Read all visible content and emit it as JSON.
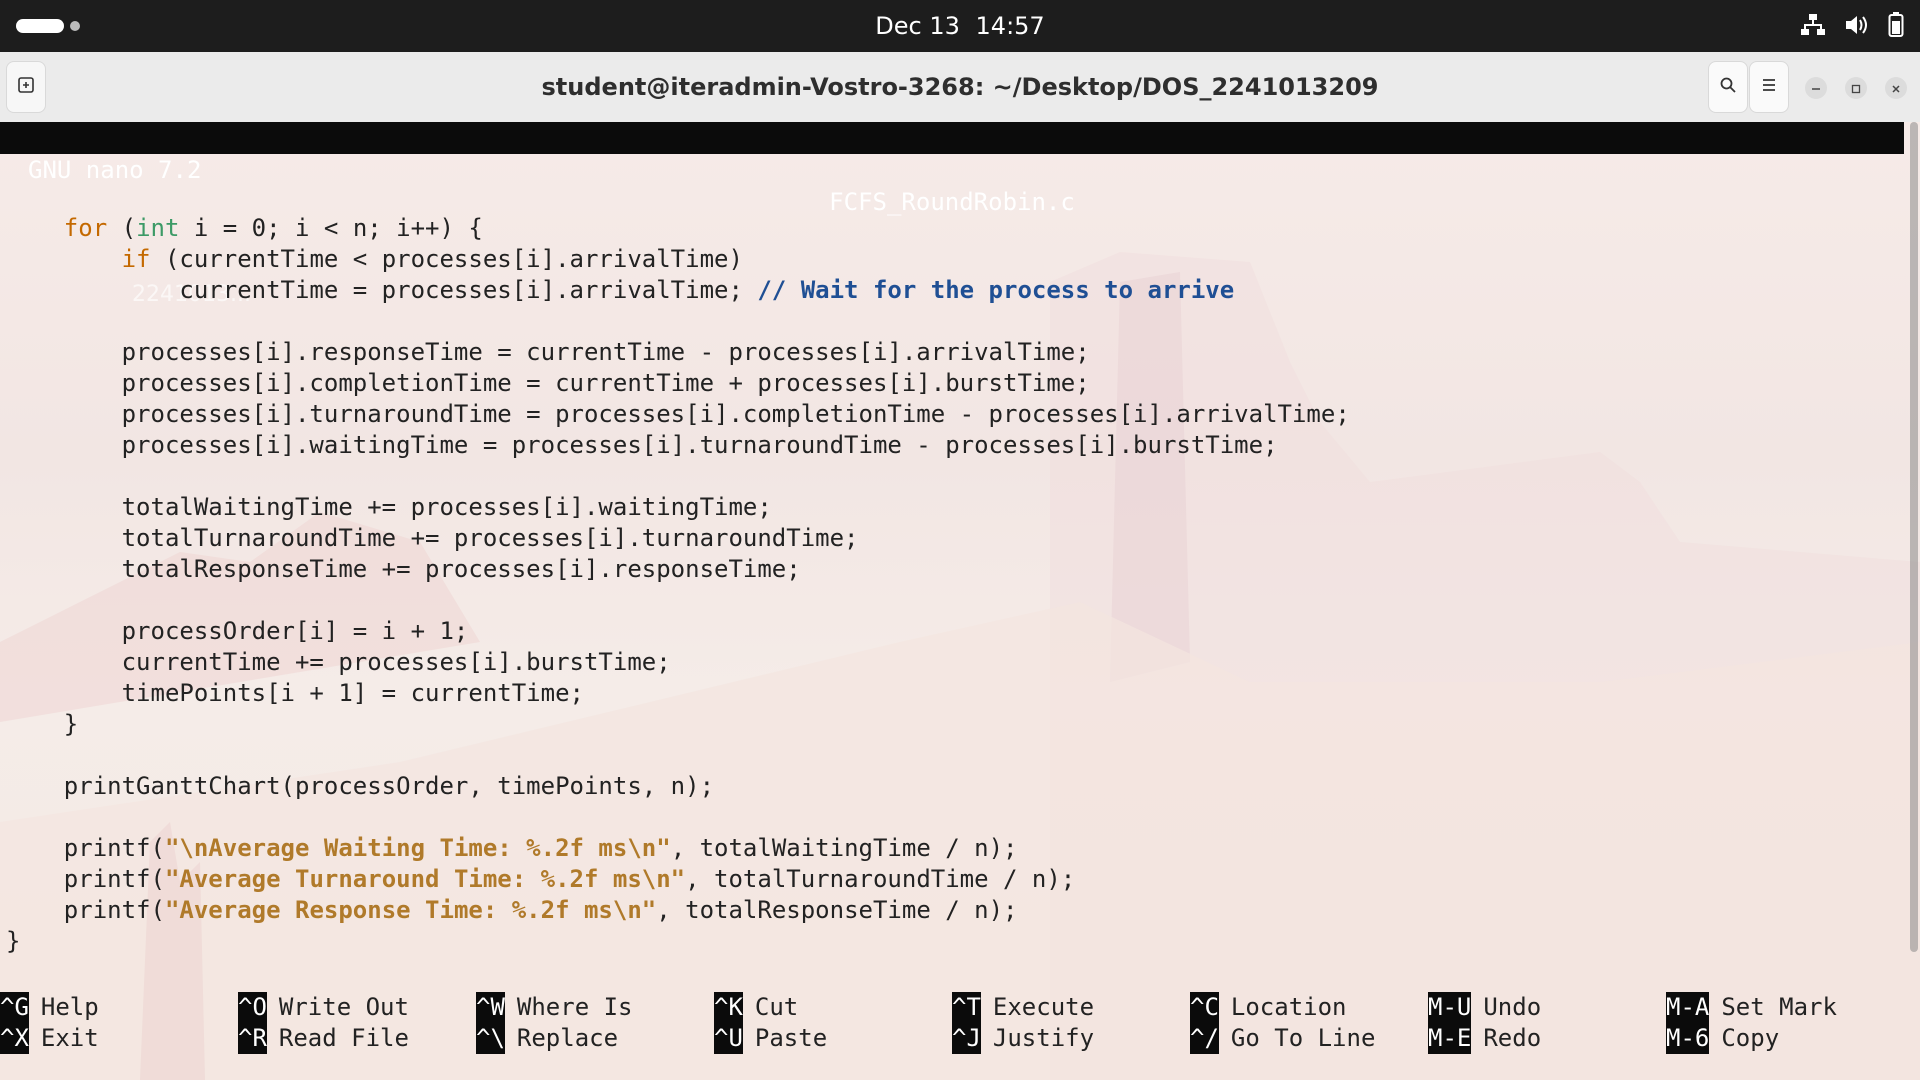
{
  "topbar": {
    "date": "Dec 13",
    "time": "14:57",
    "icons": [
      "network-icon",
      "volume-icon",
      "battery-icon"
    ]
  },
  "window": {
    "title": "student@iteradmin-Vostro-3268: ~/Desktop/DOS_2241013209",
    "buttons": [
      "new-tab-icon",
      "search-icon",
      "menu-icon",
      "minimize-icon",
      "maximize-icon",
      "close-icon"
    ]
  },
  "nano": {
    "version": "GNU nano 7.2",
    "filename": "FCFS_RoundRobin.c"
  },
  "code_lines": [
    "",
    "    for (int i = 0; i < n; i++) {",
    "        if (currentTime < processes[i].arrivalTime)",
    "            currentTime = processes[i].arrivalTime; // Wait for the process to arrive",
    "",
    "        processes[i].responseTime = currentTime - processes[i].arrivalTime;",
    "        processes[i].completionTime = currentTime + processes[i].burstTime;",
    "        processes[i].turnaroundTime = processes[i].completionTime - processes[i].arrivalTime;",
    "        processes[i].waitingTime = processes[i].turnaroundTime - processes[i].burstTime;",
    "",
    "        totalWaitingTime += processes[i].waitingTime;",
    "        totalTurnaroundTime += processes[i].turnaroundTime;",
    "        totalResponseTime += processes[i].responseTime;",
    "",
    "        processOrder[i] = i + 1;",
    "        currentTime += processes[i].burstTime;",
    "        timePoints[i + 1] = currentTime;",
    "    }",
    "",
    "    printGanttChart(processOrder, timePoints, n);",
    "",
    "    printf(\"\\nAverage Waiting Time: %.2f ms\\n\", totalWaitingTime / n);",
    "    printf(\"Average Turnaround Time: %.2f ms\\n\", totalTurnaroundTime / n);",
    "    printf(\"Average Response Time: %.2f ms\\n\", totalResponseTime / n);",
    "}"
  ],
  "desktop_ghost_label": "2241013...",
  "shortcuts": [
    {
      "key": "^G",
      "label": "Help"
    },
    {
      "key": "^X",
      "label": "Exit"
    },
    {
      "key": "^O",
      "label": "Write Out"
    },
    {
      "key": "^R",
      "label": "Read File"
    },
    {
      "key": "^W",
      "label": "Where Is"
    },
    {
      "key": "^\\",
      "label": "Replace"
    },
    {
      "key": "^K",
      "label": "Cut"
    },
    {
      "key": "^U",
      "label": "Paste"
    },
    {
      "key": "^T",
      "label": "Execute"
    },
    {
      "key": "^J",
      "label": "Justify"
    },
    {
      "key": "^C",
      "label": "Location"
    },
    {
      "key": "^/",
      "label": "Go To Line"
    },
    {
      "key": "M-U",
      "label": "Undo"
    },
    {
      "key": "M-E",
      "label": "Redo"
    },
    {
      "key": "M-A",
      "label": "Set Mark"
    },
    {
      "key": "M-6",
      "label": "Copy"
    }
  ],
  "colors": {
    "keyword": "#c46900",
    "type": "#3c9a66",
    "comment": "#1f4f94",
    "string": "#b07a2a",
    "nano_bar": "#0b0b0b"
  }
}
